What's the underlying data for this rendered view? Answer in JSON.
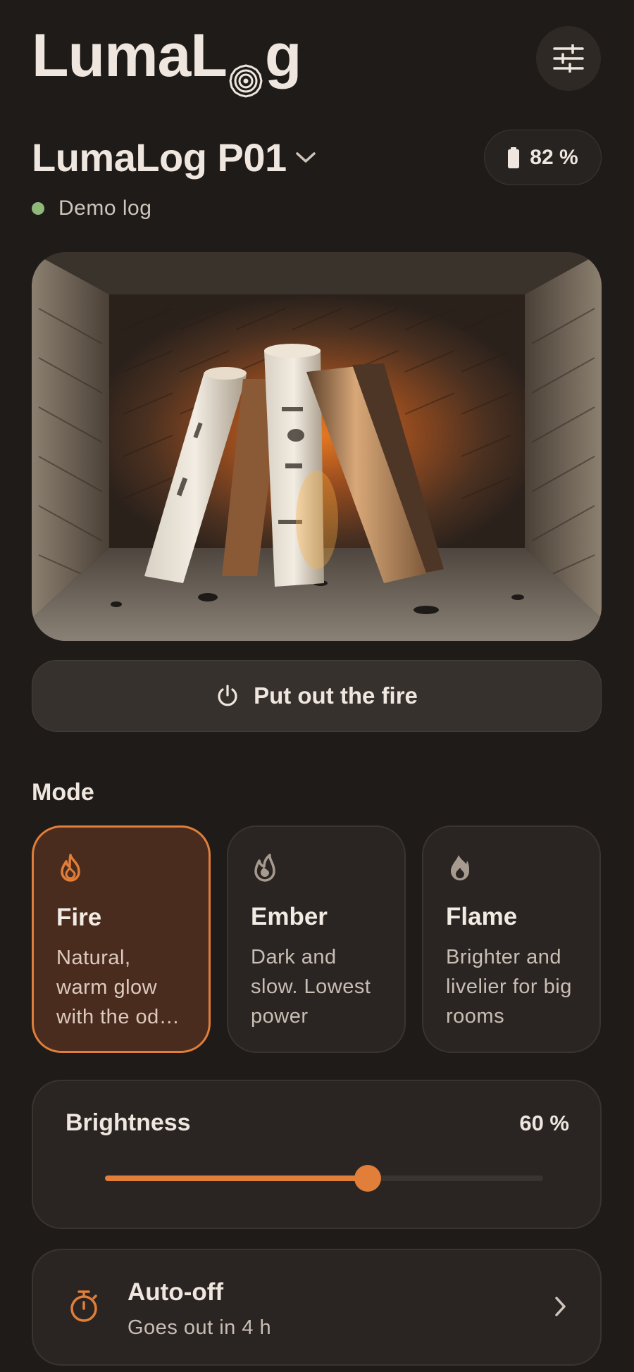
{
  "app": {
    "logo_text_before": "LumaL",
    "logo_text_after": "g"
  },
  "header": {
    "settings_icon": "sliders-icon"
  },
  "device": {
    "name": "LumaLog P01",
    "status_text": "Demo log",
    "status_color": "#8fb87a",
    "battery_label": "82 %",
    "battery_level": 0.82
  },
  "actions": {
    "put_out_label": "Put out the fire"
  },
  "mode": {
    "heading": "Mode",
    "selected": "Fire",
    "options": [
      {
        "name": "Fire",
        "description": "Natural, warm glow with the odd crackle",
        "icon": "fire-icon",
        "active": true
      },
      {
        "name": "Ember",
        "description": "Dark and slow. Lowest power",
        "icon": "ember-icon",
        "active": false
      },
      {
        "name": "Flame",
        "description": "Brighter and livelier for big rooms",
        "icon": "flame-icon",
        "active": false
      }
    ]
  },
  "brightness": {
    "label": "Brightness",
    "value_label": "60 %",
    "value": 0.6
  },
  "auto_off": {
    "title": "Auto-off",
    "subtitle": "Goes out in 4 h",
    "icon": "timer-icon"
  },
  "colors": {
    "accent": "#e07e3a",
    "background": "#1f1b18",
    "card": "#2a2522"
  }
}
